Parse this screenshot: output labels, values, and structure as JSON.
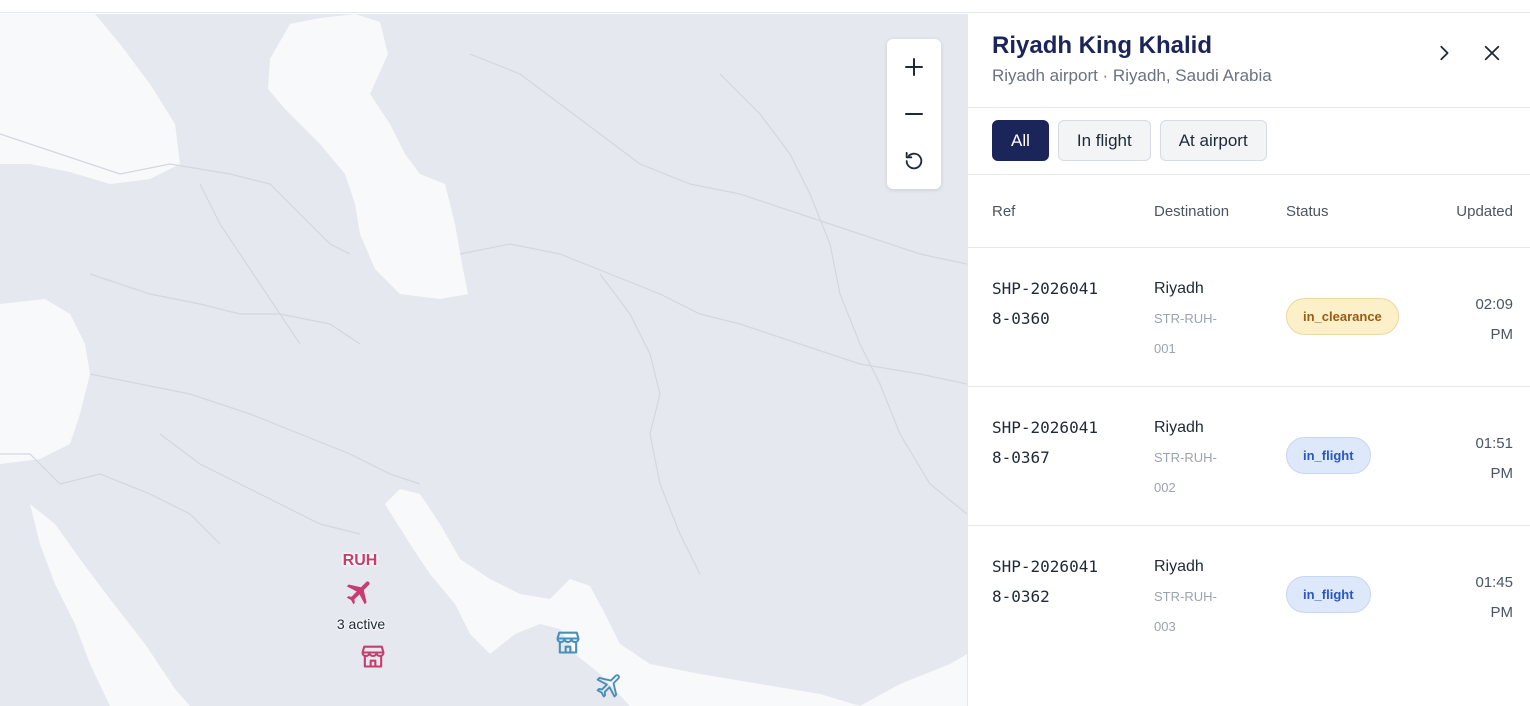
{
  "map": {
    "airport_code": "RUH",
    "active_count_label": "3 active",
    "controls": {
      "zoom_in": "+",
      "zoom_out": "−",
      "reset": "↺"
    }
  },
  "panel": {
    "title": "Riyadh King Khalid",
    "subtitle": "Riyadh airport · Riyadh, Saudi Arabia",
    "filters": [
      {
        "label": "All",
        "active": true
      },
      {
        "label": "In flight",
        "active": false
      },
      {
        "label": "At airport",
        "active": false
      }
    ],
    "columns": {
      "ref": "Ref",
      "destination": "Destination",
      "status": "Status",
      "updated": "Updated"
    },
    "rows": [
      {
        "ref": "SHP-20260418-0360",
        "destination": "Riyadh",
        "code": "STR-RUH-001",
        "status": "in_clearance",
        "updated_time": "02:09",
        "updated_ampm": "PM"
      },
      {
        "ref": "SHP-20260418-0367",
        "destination": "Riyadh",
        "code": "STR-RUH-002",
        "status": "in_flight",
        "updated_time": "01:51",
        "updated_ampm": "PM"
      },
      {
        "ref": "SHP-20260418-0362",
        "destination": "Riyadh",
        "code": "STR-RUH-003",
        "status": "in_flight",
        "updated_time": "01:45",
        "updated_ampm": "PM"
      }
    ]
  },
  "colors": {
    "accent": "#1b2559",
    "airport_marker": "#c63d6f",
    "store_marker": "#4a8fb8",
    "clearance_bg": "#fcf0c8",
    "flight_bg": "#dde8fb",
    "land": "#e5e8ee",
    "water": "#f8f9fb"
  },
  "icons": {
    "airport_marker": "plane-icon",
    "store_markers": "store-icon",
    "in_flight_marker": "plane-outline-icon",
    "header_next": "chevron-right-icon",
    "header_close": "close-icon"
  }
}
